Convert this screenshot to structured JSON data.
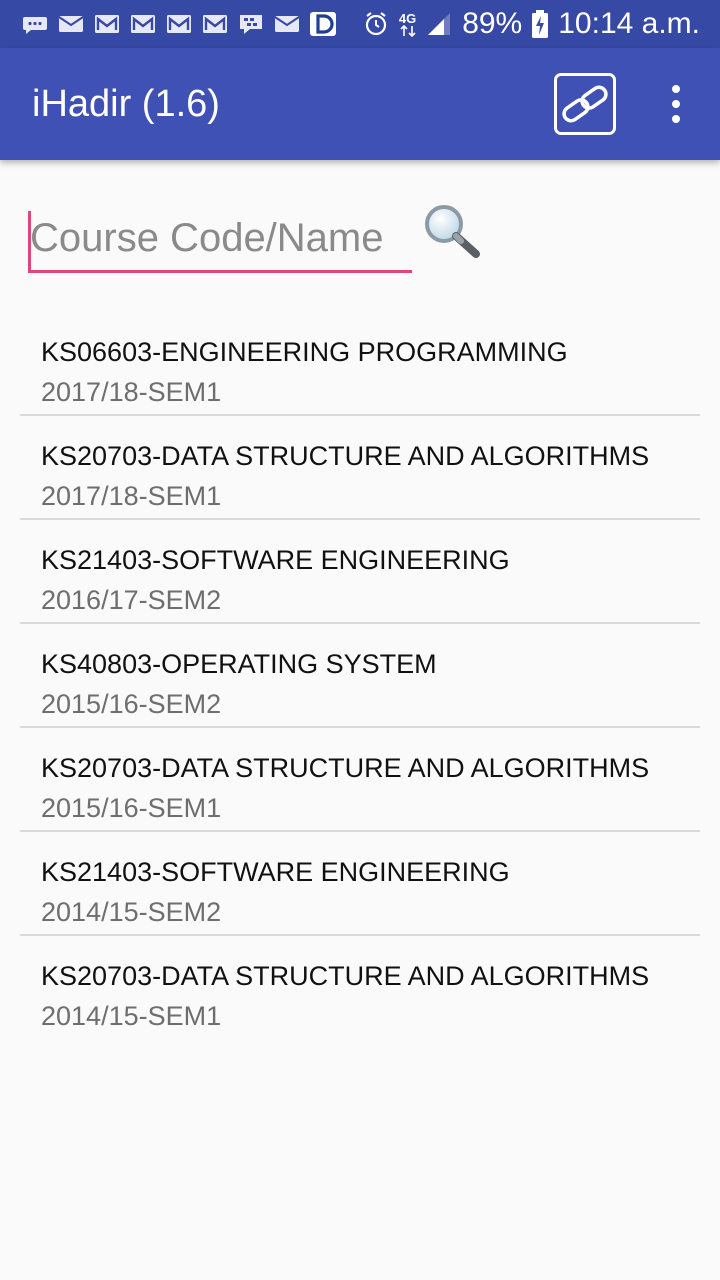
{
  "status_bar": {
    "network_label": "4G",
    "battery_text": "89%",
    "time_text": "10:14 a.m.",
    "notification_icons": [
      "chat-bubble-icon",
      "mail-icon",
      "gmail-icon",
      "gmail-icon",
      "gmail-icon",
      "gmail-icon",
      "bbm-icon",
      "mail-icon",
      "d-app-icon"
    ]
  },
  "app_bar": {
    "title": "iHadir (1.6)",
    "link_icon": "link-icon",
    "overflow_icon": "more-vert-icon"
  },
  "search": {
    "placeholder": "Course Code/Name",
    "value": "",
    "icon": "magnifier-icon"
  },
  "courses": [
    {
      "title": "KS06603-ENGINEERING PROGRAMMING",
      "term": "2017/18-SEM1"
    },
    {
      "title": "KS20703-DATA STRUCTURE AND ALGORITHMS",
      "term": "2017/18-SEM1"
    },
    {
      "title": "KS21403-SOFTWARE ENGINEERING",
      "term": "2016/17-SEM2"
    },
    {
      "title": "KS40803-OPERATING SYSTEM",
      "term": "2015/16-SEM2"
    },
    {
      "title": "KS20703-DATA STRUCTURE AND ALGORITHMS",
      "term": "2015/16-SEM1"
    },
    {
      "title": "KS21403-SOFTWARE ENGINEERING",
      "term": "2014/15-SEM2"
    },
    {
      "title": "KS20703-DATA STRUCTURE AND ALGORITHMS",
      "term": "2014/15-SEM1"
    }
  ],
  "colors": {
    "status_bar": "#3649a4",
    "app_bar": "#3f51b5",
    "accent": "#e0457b"
  }
}
